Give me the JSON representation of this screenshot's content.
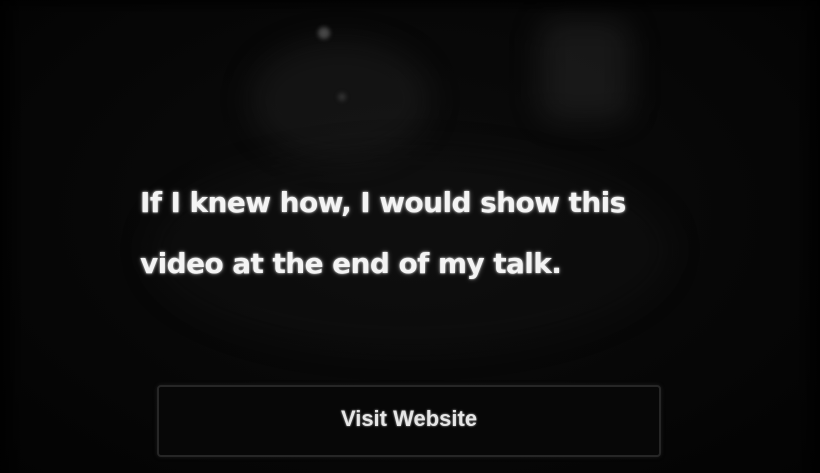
{
  "message": {
    "text": "If I knew how, I would show this video at the end of my talk."
  },
  "cta_button": {
    "label": "Visit Website"
  },
  "colors": {
    "background": "#050505",
    "text": "#f4f4f4",
    "button_border": "#262626"
  }
}
